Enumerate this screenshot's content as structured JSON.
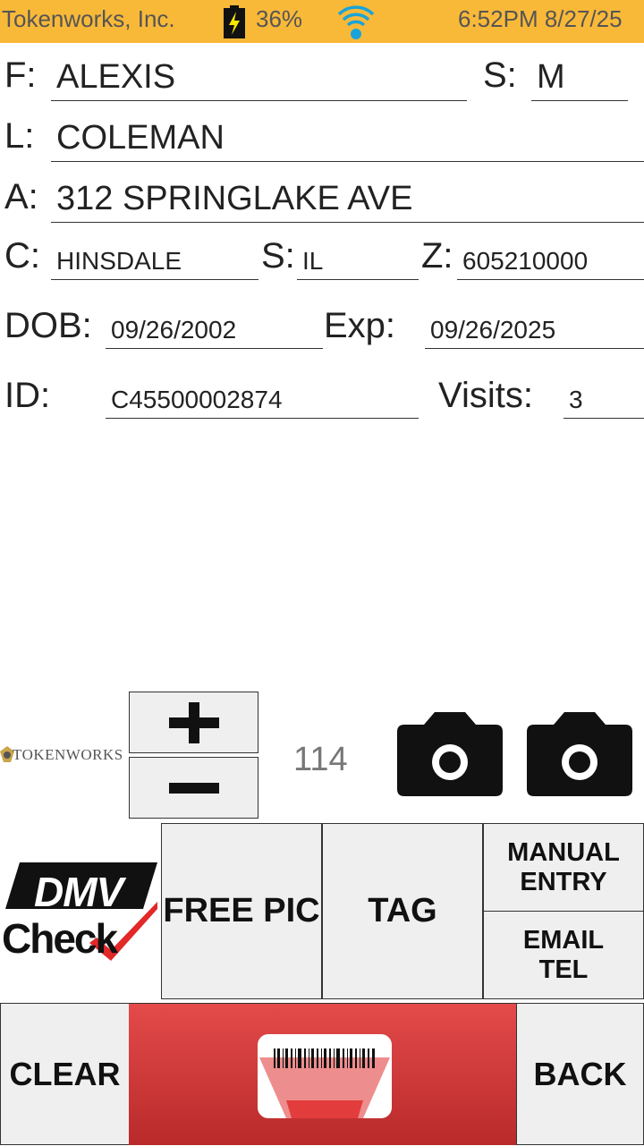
{
  "status_bar": {
    "app_name": "Tokenworks, Inc.",
    "battery": "36%",
    "datetime": "6:52PM 8/27/25",
    "color": "#f9b938"
  },
  "form": {
    "first": {
      "label": "F:",
      "value": "ALEXIS"
    },
    "sex": {
      "label": "S:",
      "value": "M"
    },
    "last": {
      "label": "L:",
      "value": "COLEMAN"
    },
    "address": {
      "label": "A:",
      "value": "312 SPRINGLAKE AVE"
    },
    "city": {
      "label": "C:",
      "value": "HINSDALE"
    },
    "state": {
      "label": "S:",
      "value": "IL"
    },
    "zip": {
      "label": "Z:",
      "value": "605210000"
    },
    "dob": {
      "label": "DOB:",
      "value": "09/26/2002"
    },
    "exp": {
      "label": "Exp:",
      "value": "09/26/2025"
    },
    "id": {
      "label": "ID:",
      "value": "C45500002874"
    },
    "visits": {
      "label": "Visits:",
      "value": "3"
    }
  },
  "controls": {
    "counter": "114",
    "tokenworks_logo": "TOKENWORKS",
    "dmv_logo_line1": "DMV",
    "dmv_logo_line2": "Check"
  },
  "buttons": {
    "free_pic": "FREE PIC",
    "tag": "TAG",
    "manual_entry_1": "MANUAL",
    "manual_entry_2": "ENTRY",
    "email_tel_1": "EMAIL",
    "email_tel_2": "TEL",
    "clear": "CLEAR",
    "back": "BACK"
  },
  "colors": {
    "scan_button": "#d63a3a"
  }
}
